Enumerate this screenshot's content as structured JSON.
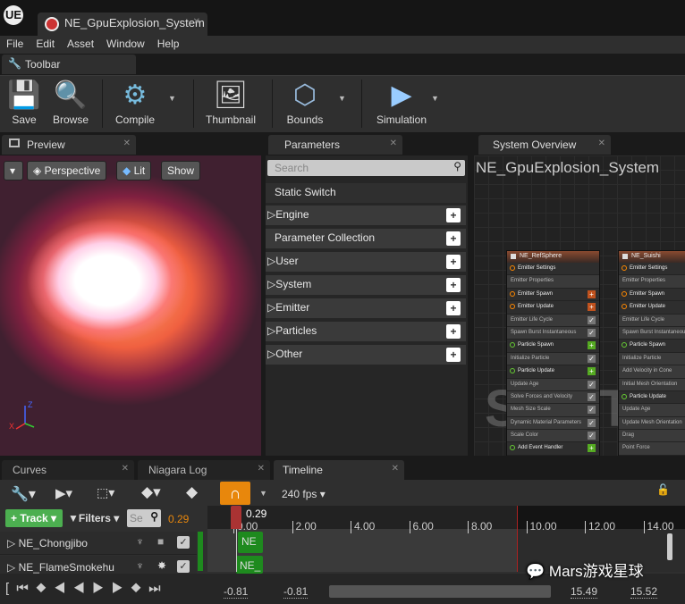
{
  "window": {
    "title": "NE_GpuExplosion_System",
    "logo": "UE"
  },
  "menu": [
    "File",
    "Edit",
    "Asset",
    "Window",
    "Help"
  ],
  "toolbar_tab": "Toolbar",
  "toolbar": {
    "save": "Save",
    "browse": "Browse",
    "compile": "Compile",
    "thumbnail": "Thumbnail",
    "bounds": "Bounds",
    "simulation": "Simulation"
  },
  "panels": {
    "preview": "Preview",
    "parameters": "Parameters",
    "system_overview": "System Overview"
  },
  "viewport": {
    "perspective": "Perspective",
    "lit": "Lit",
    "show": "Show",
    "axis_z": "Z",
    "axis_x": "X"
  },
  "parameters": {
    "search_placeholder": "Search",
    "static_switch": "Static Switch",
    "categories": [
      "Engine",
      "Parameter Collection",
      "User",
      "System",
      "Emitter",
      "Particles",
      "Other"
    ]
  },
  "system_overview": {
    "title": "NE_GpuExplosion_System",
    "watermark": "SYSTEM",
    "emitters": [
      {
        "name": "NE_RefSphere",
        "rows": [
          "Emitter Settings",
          "Emitter Properties",
          "Emitter Spawn",
          "Emitter Update",
          "Emitter Life Cycle",
          "Spawn Burst Instantaneous",
          "Particle Spawn",
          "Initialize Particle",
          "Particle Update",
          "Update Age",
          "Solve Forces and Velocity",
          "Mesh Size Scale",
          "Dynamic Material Parameters",
          "Scale Color",
          "Add Event Handler"
        ]
      },
      {
        "name": "NE_Suishi",
        "rows": [
          "Emitter Settings",
          "Emitter Properties",
          "Emitter Spawn",
          "Emitter Update",
          "Emitter Life Cycle",
          "Spawn Burst Instantaneous",
          "Particle Spawn",
          "Initialize Particle",
          "Add Velocity in Cone",
          "Initial Mesh Orientation",
          "Particle Update",
          "Update Age",
          "Update Mesh Orientation",
          "Drag",
          "Point Force"
        ]
      }
    ]
  },
  "bottom_tabs": [
    "Curves",
    "Niagara Log",
    "Timeline"
  ],
  "timeline": {
    "fps": "240 fps",
    "track_button": "Track",
    "filters": "Filters",
    "search_placeholder": "Se",
    "current_time": "0.29",
    "playhead_label": "0.29",
    "ruler": [
      "0.00",
      "2.00",
      "4.00",
      "6.00",
      "8.00",
      "10.00",
      "12.00",
      "14.00"
    ],
    "tracks": [
      {
        "name": "NE_Chongjibo",
        "clip": "NE"
      },
      {
        "name": "NE_FlameSmokehu",
        "clip": "NE_"
      }
    ],
    "range": {
      "view_start": "-0.81",
      "work_start": "-0.81",
      "view_end": "15.49",
      "work_end": "15.52"
    }
  },
  "watermark_text": "Mars游戏星球",
  "colors": {
    "accent_orange": "#e8870c",
    "track_green": "#1e8a1e",
    "add_green": "#4caf50"
  }
}
